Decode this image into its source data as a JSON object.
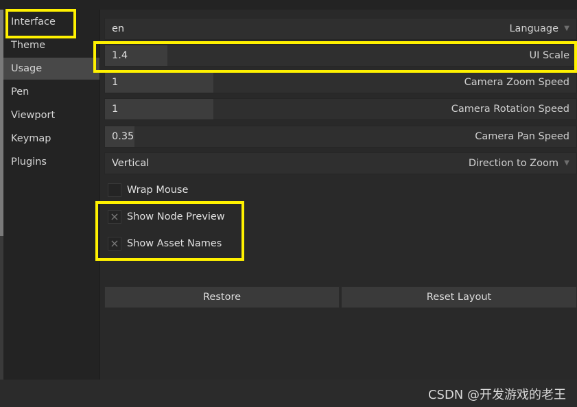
{
  "sidebar": {
    "items": [
      {
        "label": "Interface"
      },
      {
        "label": "Theme"
      },
      {
        "label": "Usage"
      },
      {
        "label": "Pen"
      },
      {
        "label": "Viewport"
      },
      {
        "label": "Keymap"
      },
      {
        "label": "Plugins"
      }
    ],
    "active": "Usage"
  },
  "settings": {
    "language": {
      "value": "en",
      "label": "Language"
    },
    "ui_scale": {
      "value": "1.4",
      "label": "UI Scale"
    },
    "camera_zoom_speed": {
      "value": "1",
      "label": "Camera Zoom Speed"
    },
    "camera_rotation_speed": {
      "value": "1",
      "label": "Camera Rotation Speed"
    },
    "camera_pan_speed": {
      "value": "0.35",
      "label": "Camera Pan Speed"
    },
    "direction_to_zoom": {
      "value": "Vertical",
      "label": "Direction to Zoom"
    },
    "wrap_mouse": {
      "label": "Wrap Mouse",
      "checked": false
    },
    "show_node_preview": {
      "label": "Show Node Preview",
      "checked": true
    },
    "show_asset_names": {
      "label": "Show Asset Names",
      "checked": true
    }
  },
  "buttons": {
    "restore": "Restore",
    "reset_layout": "Reset Layout"
  },
  "icons": {
    "dropdown": "chevron-down-icon",
    "check": "x-check-icon"
  },
  "colors": {
    "highlight": "#fff100",
    "active_item": "#484848"
  },
  "watermark": "CSDN @开发游戏的老王"
}
